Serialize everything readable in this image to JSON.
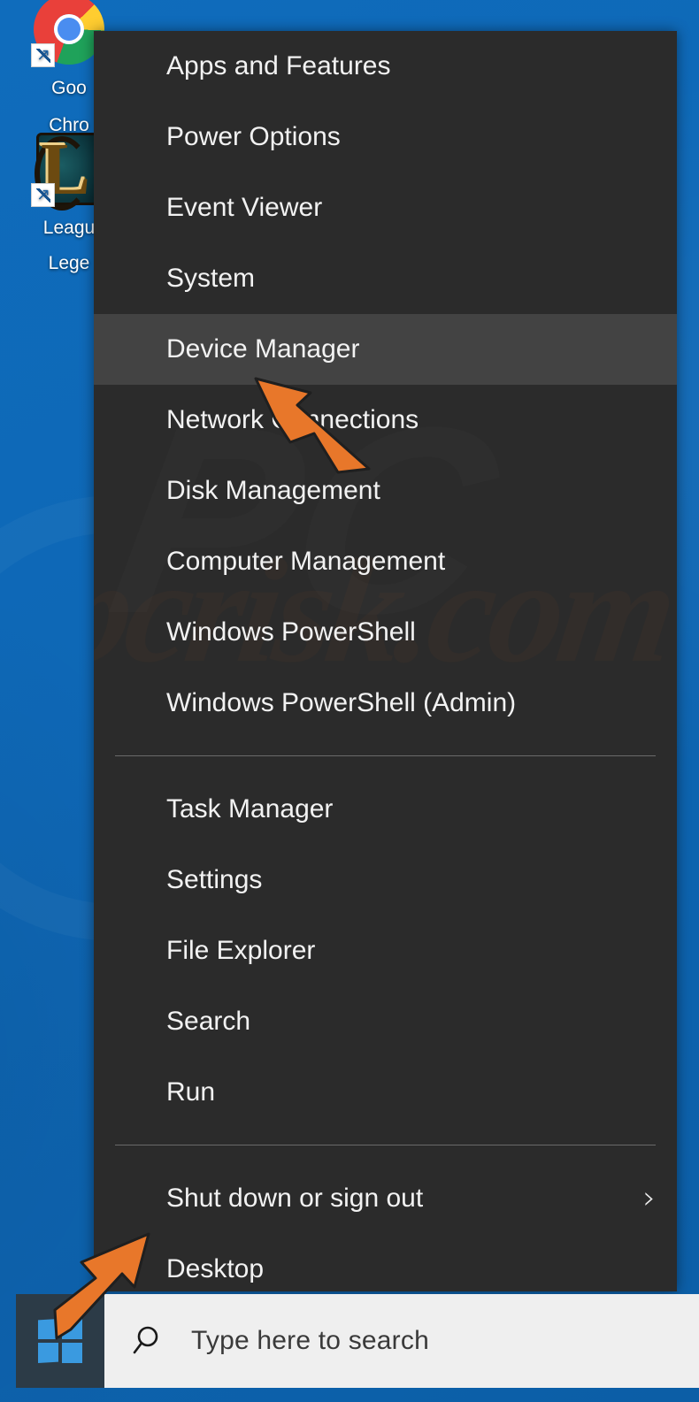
{
  "desktop": {
    "icons": [
      {
        "name": "google-chrome",
        "icon": "chrome-icon",
        "label_line1": "Goo",
        "label_line2": "Chro",
        "full_label": "Google Chrome"
      },
      {
        "name": "league-of-legends",
        "icon": "league-of-legends-icon",
        "label_line1": "Leagu",
        "label_line2": "Lege",
        "full_label": "League of Legends"
      }
    ],
    "background_color": "#0E67B5"
  },
  "winx_menu": {
    "background_color": "#2B2B2B",
    "highlight_color": "#434343",
    "watermark": "pcrisk.com",
    "items": [
      {
        "label": "Apps and Features",
        "highlighted": false,
        "has_submenu": false
      },
      {
        "label": "Power Options",
        "highlighted": false,
        "has_submenu": false
      },
      {
        "label": "Event Viewer",
        "highlighted": false,
        "has_submenu": false
      },
      {
        "label": "System",
        "highlighted": false,
        "has_submenu": false
      },
      {
        "label": "Device Manager",
        "highlighted": true,
        "has_submenu": false
      },
      {
        "label": "Network Connections",
        "highlighted": false,
        "has_submenu": false
      },
      {
        "label": "Disk Management",
        "highlighted": false,
        "has_submenu": false
      },
      {
        "label": "Computer Management",
        "highlighted": false,
        "has_submenu": false
      },
      {
        "label": "Windows PowerShell",
        "highlighted": false,
        "has_submenu": false
      },
      {
        "label": "Windows PowerShell (Admin)",
        "highlighted": false,
        "has_submenu": false
      },
      {
        "label": "Task Manager",
        "highlighted": false,
        "has_submenu": false
      },
      {
        "label": "Settings",
        "highlighted": false,
        "has_submenu": false
      },
      {
        "label": "File Explorer",
        "highlighted": false,
        "has_submenu": false
      },
      {
        "label": "Search",
        "highlighted": false,
        "has_submenu": false
      },
      {
        "label": "Run",
        "highlighted": false,
        "has_submenu": false
      },
      {
        "label": "Shut down or sign out",
        "highlighted": false,
        "has_submenu": true
      },
      {
        "label": "Desktop",
        "highlighted": false,
        "has_submenu": false
      }
    ],
    "submenu_chevron": "›"
  },
  "taskbar": {
    "start_button": {
      "icon": "windows-logo-icon",
      "background_color": "#2C3B47",
      "logo_color": "#3A9AE0"
    },
    "search": {
      "icon": "search-icon",
      "placeholder": "Type here to search",
      "value": "",
      "background_color": "#EFEFEF"
    }
  },
  "annotations": {
    "color": "#E8772A",
    "arrows": [
      {
        "name": "arrow-pointing-device-manager",
        "target": "Device Manager",
        "direction": "up-left"
      },
      {
        "name": "arrow-pointing-start-button",
        "target": "Start button",
        "direction": "down-left"
      }
    ]
  }
}
